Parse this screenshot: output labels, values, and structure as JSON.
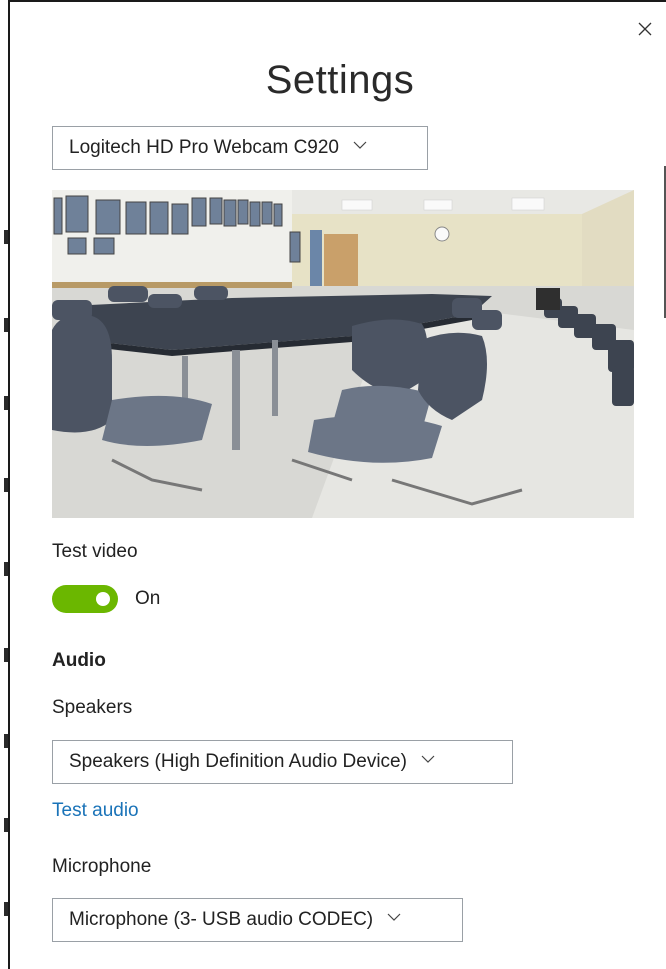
{
  "dialog": {
    "title": "Settings",
    "close_icon": "close-icon"
  },
  "camera": {
    "selected": "Logitech HD Pro Webcam C920"
  },
  "test_video": {
    "label": "Test video",
    "toggle_state": "On",
    "toggle_on": true
  },
  "audio": {
    "heading": "Audio",
    "speakers_label": "Speakers",
    "speakers_selected": "Speakers (High Definition Audio Device)",
    "test_audio_link": "Test audio",
    "microphone_label": "Microphone",
    "microphone_selected": "Microphone (3- USB audio CODEC)"
  },
  "colors": {
    "toggle_on": "#6bb700",
    "link": "#1a73b8"
  }
}
